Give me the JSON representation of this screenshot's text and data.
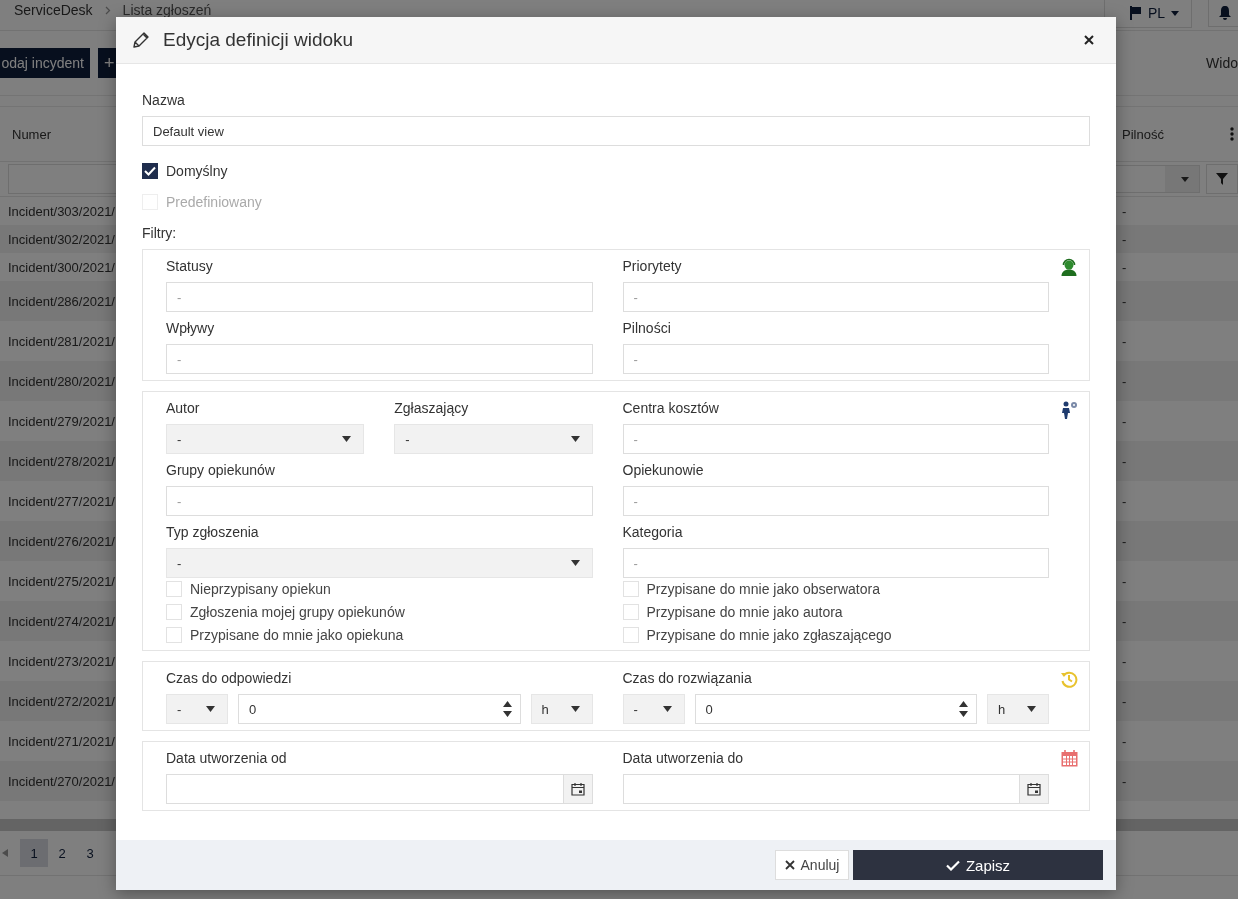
{
  "app": {
    "breadcrumb": [
      "ServiceDesk",
      "Lista zgłoszeń"
    ],
    "language": "PL",
    "toolbar_buttons": [
      "odaj incydent",
      "+"
    ],
    "views_label": "Wido"
  },
  "table": {
    "columns": [
      "Numer",
      "Pilność"
    ],
    "rows": [
      {
        "number": "Incident/303/2021/",
        "urgency": "-"
      },
      {
        "number": "Incident/302/2021/",
        "urgency": "-"
      },
      {
        "number": "Incident/300/2021/",
        "urgency": "-"
      },
      {
        "number": "Incident/286/2021/",
        "urgency": "-"
      },
      {
        "number": "Incident/281/2021/",
        "urgency": "-"
      },
      {
        "number": "Incident/280/2021/",
        "urgency": "-"
      },
      {
        "number": "Incident/279/2021/",
        "urgency": "-"
      },
      {
        "number": "Incident/278/2021/",
        "urgency": "-"
      },
      {
        "number": "Incident/277/2021/",
        "urgency": "-"
      },
      {
        "number": "Incident/276/2021/",
        "urgency": "-"
      },
      {
        "number": "Incident/275/2021/",
        "urgency": "-"
      },
      {
        "number": "Incident/274/2021/",
        "urgency": "-"
      },
      {
        "number": "Incident/273/2021/",
        "urgency": "-"
      },
      {
        "number": "Incident/272/2021/",
        "urgency": "-"
      },
      {
        "number": "Incident/271/2021/",
        "urgency": "-"
      },
      {
        "number": "Incident/270/2021/",
        "urgency": "-"
      }
    ],
    "pages": [
      {
        "label": "1",
        "selected": true
      },
      {
        "label": "2",
        "selected": false
      },
      {
        "label": "3",
        "selected": false
      }
    ]
  },
  "dialog": {
    "title": "Edycja definicji widoku",
    "name_label": "Nazwa",
    "name_value": "Default view",
    "options": [
      {
        "label": "Domyślny",
        "checked": true,
        "disabled": false
      },
      {
        "label": "Predefiniowany",
        "checked": false,
        "disabled": true
      }
    ],
    "filters_label": "Filtry:",
    "sections": [
      {
        "rows": [
          {
            "left": [
              {
                "label": "Statusy",
                "kind": "text",
                "placeholder": "-"
              }
            ],
            "right": [
              {
                "label": "Priorytety",
                "kind": "text",
                "placeholder": "-"
              }
            ]
          },
          {
            "left": [
              {
                "label": "Wpływy",
                "kind": "text",
                "placeholder": "-"
              }
            ],
            "right": [
              {
                "label": "Pilności",
                "kind": "text",
                "placeholder": "-"
              }
            ]
          }
        ]
      },
      {
        "rows": [
          {
            "left": [
              {
                "label": "Autor",
                "kind": "select",
                "value": "-"
              },
              {
                "label": "Zgłaszający",
                "kind": "select",
                "value": "-"
              }
            ],
            "right": [
              {
                "label": "Centra kosztów",
                "kind": "text",
                "placeholder": "-"
              }
            ]
          },
          {
            "left": [
              {
                "label": "Grupy opiekunów",
                "kind": "text",
                "placeholder": "-"
              }
            ],
            "right": [
              {
                "label": "Opiekunowie",
                "kind": "text",
                "placeholder": "-"
              }
            ]
          },
          {
            "left": [
              {
                "label": "Typ zgłoszenia",
                "kind": "select",
                "value": "-"
              }
            ],
            "right": [
              {
                "label": "Kategoria",
                "kind": "text",
                "placeholder": "-"
              }
            ]
          }
        ],
        "checks": {
          "left": [
            {
              "label": "Nieprzypisany opiekun",
              "checked": false
            },
            {
              "label": "Zgłoszenia mojej grupy opiekunów",
              "checked": false
            },
            {
              "label": "Przypisane do mnie jako opiekuna",
              "checked": false
            }
          ],
          "right": [
            {
              "label": "Przypisane do mnie jako obserwatora",
              "checked": false
            },
            {
              "label": "Przypisane do mnie jako autora",
              "checked": false
            },
            {
              "label": "Przypisane do mnie jako zgłaszającego",
              "checked": false
            }
          ]
        }
      },
      {
        "rows": [
          {
            "left": [
              {
                "label": "Czas do odpowiedzi",
                "kind": "duration",
                "operator": "-",
                "value": "0",
                "unit": "h"
              }
            ],
            "right": [
              {
                "label": "Czas do rozwiązania",
                "kind": "duration",
                "operator": "-",
                "value": "0",
                "unit": "h"
              }
            ]
          }
        ]
      },
      {
        "rows": [
          {
            "left": [
              {
                "label": "Data utworzenia od",
                "kind": "date"
              }
            ],
            "right": [
              {
                "label": "Data utworzenia do",
                "kind": "date"
              }
            ]
          }
        ]
      }
    ],
    "buttons": {
      "cancel": "Anuluj",
      "save": "Zapisz"
    }
  }
}
